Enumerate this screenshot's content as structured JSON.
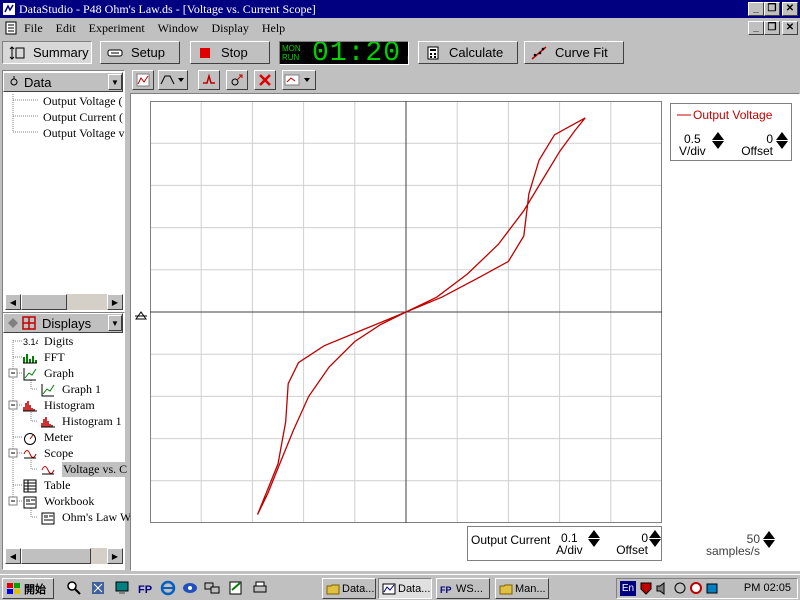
{
  "window": {
    "title": "DataStudio - P48 Ohm's Law.ds - [Voltage vs. Current Scope]"
  },
  "menu": [
    "File",
    "Edit",
    "Experiment",
    "Window",
    "Display",
    "Help"
  ],
  "toolbar": {
    "summary": "Summary",
    "setup": "Setup",
    "stop": "Stop",
    "lcd_mon": "MON",
    "lcd_run": "RUN",
    "lcd_time": "01:20.2",
    "calculate": "Calculate",
    "curve_fit": "Curve Fit"
  },
  "data_panel": {
    "header": "Data",
    "items": [
      "Output Voltage (",
      "Output Current (",
      "Output Voltage v"
    ]
  },
  "displays_panel": {
    "header": "Displays",
    "items": [
      {
        "label": "Digits",
        "icon": "digits-icon",
        "indent": 0
      },
      {
        "label": "FFT",
        "icon": "fft-icon",
        "indent": 0
      },
      {
        "label": "Graph",
        "icon": "graph-icon",
        "indent": 0
      },
      {
        "label": "Graph 1",
        "icon": "graph-icon",
        "indent": 1
      },
      {
        "label": "Histogram",
        "icon": "histogram-icon",
        "indent": 0
      },
      {
        "label": "Histogram 1",
        "icon": "histogram-icon",
        "indent": 1
      },
      {
        "label": "Meter",
        "icon": "meter-icon",
        "indent": 0
      },
      {
        "label": "Scope",
        "icon": "scope-icon",
        "indent": 0
      },
      {
        "label": "Voltage vs. C",
        "icon": "scope-icon",
        "indent": 1
      },
      {
        "label": "Table",
        "icon": "table-icon",
        "indent": 0
      },
      {
        "label": "Workbook",
        "icon": "workbook-icon",
        "indent": 0
      },
      {
        "label": "Ohm's Law W",
        "icon": "workbook-icon",
        "indent": 1
      }
    ],
    "digits_glyph": "3.14"
  },
  "scope": {
    "y_legend": {
      "name": "Output Voltage",
      "scale": "0.5",
      "scale_unit": "V/div",
      "offset": "0",
      "offset_label": "Offset",
      "color": "#c00000"
    },
    "x_legend": {
      "name": "Output Current",
      "scale": "0.1",
      "scale_unit": "A/div",
      "offset": "0",
      "offset_label": "Offset"
    },
    "sample_rate": "50",
    "sample_rate_unit": "samples/s",
    "grid_divisions": {
      "x": 10,
      "y": 10
    }
  },
  "taskbar": {
    "start": "開始",
    "tasks": [
      "Data...",
      "Data...",
      "WS...",
      "Man..."
    ],
    "lang": "En",
    "clock": "PM 02:05"
  }
}
